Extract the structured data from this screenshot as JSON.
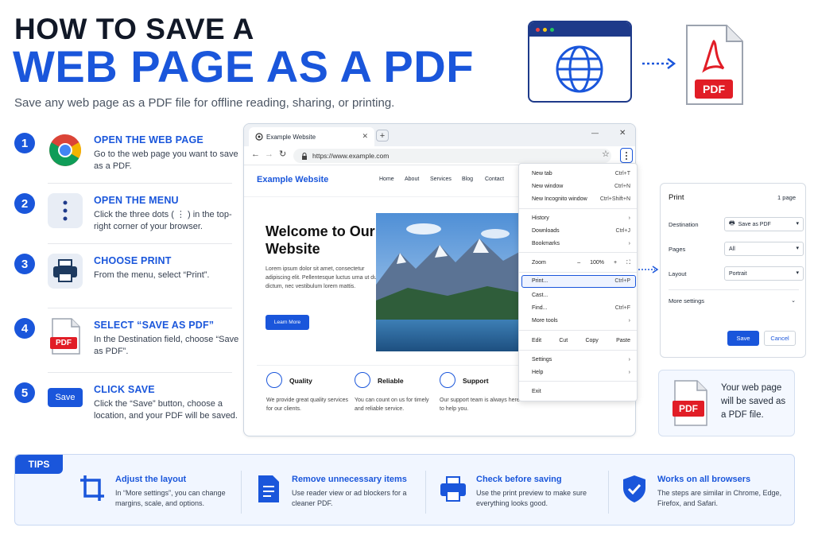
{
  "title": {
    "line1": "HOW TO SAVE A",
    "line2": "WEB PAGE AS A PDF",
    "subtitle": "Save any web page as a PDF file for offline reading, sharing, or printing."
  },
  "header_pdf_label": "PDF",
  "steps": [
    {
      "num": "1",
      "title": "OPEN THE WEB PAGE",
      "text": "Go to the web page you want to save as a PDF.",
      "icon": "chrome-icon"
    },
    {
      "num": "2",
      "title": "OPEN THE MENU",
      "text": "Click the three dots ( ⋮ ) in the top-right corner of your browser.",
      "icon": "three-dots-icon"
    },
    {
      "num": "3",
      "title": "CHOOSE PRINT",
      "text": "From the menu, select “Print”.",
      "icon": "printer-icon"
    },
    {
      "num": "4",
      "title": "SELECT “SAVE AS PDF”",
      "text": "In the Destination field, choose “Save as PDF”.",
      "icon": "pdf-file-icon",
      "icon_label": "PDF"
    },
    {
      "num": "5",
      "title": "CLICK SAVE",
      "text": "Click the “Save” button, choose a location, and your PDF will be saved.",
      "icon": "save-button-icon",
      "icon_label": "Save"
    }
  ],
  "browser": {
    "tab_title": "Example Website",
    "new_tab": "+",
    "url": "https://www.example.com",
    "site_name": "Example Website",
    "nav": [
      "Home",
      "About",
      "Services",
      "Blog",
      "Contact"
    ],
    "hero_title": "Welcome to Our Website",
    "hero_text": "Lorem ipsum dolor sit amet, consectetur adipiscing elit. Pellentesque luctus urna ut dui dictum, nec vestibulum lorem mattis.",
    "hero_button": "Learn More",
    "features": [
      {
        "title": "Quality",
        "text": "We provide great quality services for our clients."
      },
      {
        "title": "Reliable",
        "text": "You can count on us for timely and reliable service."
      },
      {
        "title": "Support",
        "text": "Our support team is always here to help you."
      }
    ]
  },
  "menu": {
    "new_tab": {
      "label": "New tab",
      "key": "Ctrl+T"
    },
    "new_window": {
      "label": "New window",
      "key": "Ctrl+N"
    },
    "incognito": {
      "label": "New Incognito window",
      "key": "Ctrl+Shift+N"
    },
    "history": {
      "label": "History",
      "key": "›"
    },
    "downloads": {
      "label": "Downloads",
      "key": "Ctrl+J"
    },
    "bookmarks": {
      "label": "Bookmarks",
      "key": "›"
    },
    "zoom": {
      "label": "Zoom",
      "minus": "–",
      "value": "100%",
      "plus": "+"
    },
    "print": {
      "label": "Print...",
      "key": "Ctrl+P"
    },
    "cast": {
      "label": "Cast...",
      "key": ""
    },
    "find": {
      "label": "Find...",
      "key": "Ctrl+F"
    },
    "more_tools": {
      "label": "More tools",
      "key": "›"
    },
    "edit": [
      "Edit",
      "Cut",
      "Copy",
      "Paste"
    ],
    "settings": {
      "label": "Settings",
      "key": "›"
    },
    "help": {
      "label": "Help",
      "key": "›"
    },
    "exit": {
      "label": "Exit",
      "key": ""
    }
  },
  "print_panel": {
    "title": "Print",
    "pages_count": "1 page",
    "destination_label": "Destination",
    "destination_value": "Save as PDF",
    "pages_label": "Pages",
    "pages_value": "All",
    "layout_label": "Layout",
    "layout_value": "Portrait",
    "more_settings": "More settings",
    "save": "Save",
    "cancel": "Cancel"
  },
  "note": {
    "pdf_label": "PDF",
    "text": "Your web page will be saved as a PDF file."
  },
  "tips": {
    "badge": "TIPS",
    "items": [
      {
        "title": "Adjust the layout",
        "text": "In “More settings”, you can change margins, scale, and options."
      },
      {
        "title": "Remove unnecessary items",
        "text": "Use reader view or ad blockers for a cleaner PDF."
      },
      {
        "title": "Check before saving",
        "text": "Use the print preview to make sure everything looks good."
      },
      {
        "title": "Works on all browsers",
        "text": "The steps are similar in Chrome, Edge, Firefox, and Safari."
      }
    ]
  },
  "colors": {
    "accent": "#1a56db",
    "navy": "#1e3a8a",
    "pdf_red": "#e11d26"
  }
}
